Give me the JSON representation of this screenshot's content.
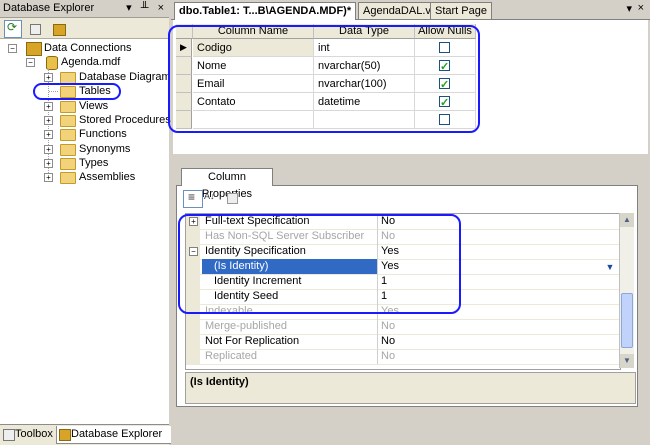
{
  "explorer": {
    "title": "Database Explorer",
    "title_buttons": "▾ ╨ ×",
    "tree": {
      "data_connections": "Data Connections",
      "db_file": "Agenda.mdf",
      "folders": [
        "Database Diagrams",
        "Tables",
        "Views",
        "Stored Procedures",
        "Functions",
        "Synonyms",
        "Types",
        "Assemblies"
      ]
    },
    "bottom_tabs": [
      "Toolbox",
      "Database Explorer"
    ]
  },
  "doc_tabs": [
    "dbo.Table1: T...B\\AGENDA.MDF)*",
    "AgendaDAL.vb",
    "Start Page"
  ],
  "designer": {
    "headers": [
      "Column Name",
      "Data Type",
      "Allow Nulls"
    ],
    "rows": [
      {
        "name": "Codigo",
        "type": "int",
        "nulls": false
      },
      {
        "name": "Nome",
        "type": "nvarchar(50)",
        "nulls": true
      },
      {
        "name": "Email",
        "type": "nvarchar(100)",
        "nulls": true
      },
      {
        "name": "Contato",
        "type": "datetime",
        "nulls": true
      },
      {
        "name": "",
        "type": "",
        "nulls": false
      }
    ]
  },
  "column_properties": {
    "tab_label": "Column Properties",
    "rows": [
      {
        "name": "Full-text Specification",
        "value": "No"
      },
      {
        "name": "Has Non-SQL Server Subscriber",
        "value": "No"
      },
      {
        "name": "Identity Specification",
        "value": "Yes"
      },
      {
        "name": "(Is Identity)",
        "value": "Yes"
      },
      {
        "name": "Identity Increment",
        "value": "1"
      },
      {
        "name": "Identity Seed",
        "value": "1"
      },
      {
        "name": "Indexable",
        "value": "Yes"
      },
      {
        "name": "Merge-published",
        "value": "No"
      },
      {
        "name": "Not For Replication",
        "value": "No"
      },
      {
        "name": "Replicated",
        "value": "No"
      }
    ],
    "description": "(Is Identity)"
  }
}
